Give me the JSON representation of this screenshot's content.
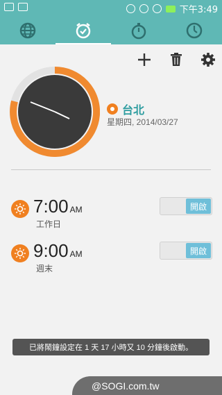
{
  "status_bar": {
    "time": "下午3:49",
    "left_icons": [
      "gallery-icon",
      "mail-icon"
    ],
    "right_icons": [
      "alarm-icon",
      "wifi-icon",
      "signal-icon",
      "battery-icon"
    ]
  },
  "tabs": [
    {
      "icon": "world-clock-icon",
      "active": false
    },
    {
      "icon": "alarm-clock-icon",
      "active": true
    },
    {
      "icon": "stopwatch-icon",
      "active": false
    },
    {
      "icon": "timer-icon",
      "active": false
    }
  ],
  "toolbar": {
    "icons": [
      "add-icon",
      "delete-icon",
      "settings-icon"
    ]
  },
  "world_clock": {
    "city": "台北",
    "date": "星期四, 2014/03/27",
    "accent_color": "#f08a30"
  },
  "alarms": [
    {
      "time": "7:00",
      "ampm": "AM",
      "label": "工作日",
      "toggle_text": "開啟",
      "enabled": true
    },
    {
      "time": "9:00",
      "ampm": "AM",
      "label": "週末",
      "toggle_text": "開啟",
      "enabled": true
    }
  ],
  "toast": {
    "text": "已將鬧鐘設定在 1 天 17 小時又 10 分鐘後啟動。"
  },
  "watermark": {
    "text": "@SOGI.com.tw"
  },
  "colors": {
    "header_bg": "#5fb8b5",
    "accent_orange": "#f08020",
    "toggle_on": "#6fbfd9"
  }
}
